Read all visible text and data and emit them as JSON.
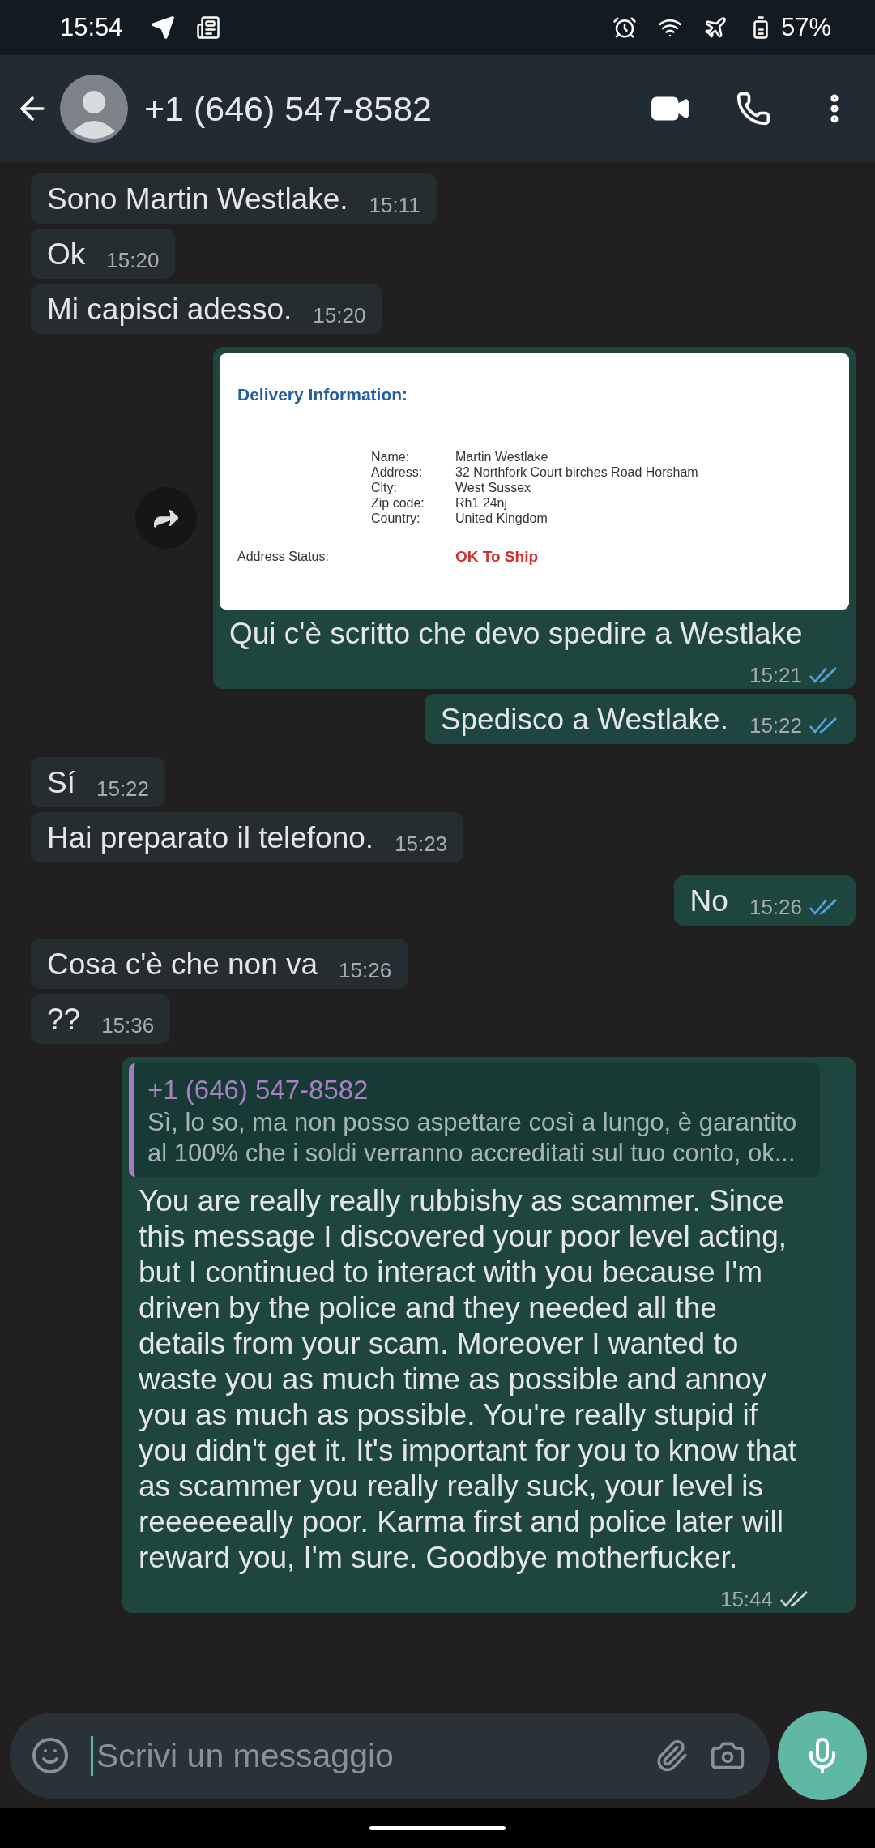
{
  "status_bar": {
    "time": "15:54",
    "battery": "57%"
  },
  "header": {
    "title": "+1 (646) 547-8582"
  },
  "messages": [
    {
      "kind": "text",
      "outgoing": false,
      "text": "Sono Martin Westlake.",
      "time": "15:11"
    },
    {
      "kind": "text",
      "outgoing": false,
      "text": "Ok",
      "time": "15:20"
    },
    {
      "kind": "text",
      "outgoing": false,
      "text": "Mi capisci adesso.",
      "time": "15:20"
    },
    {
      "kind": "image",
      "outgoing": true,
      "read": true,
      "document": {
        "title": "Delivery Information:",
        "rows": [
          {
            "label": "Name:",
            "value": "Martin Westlake"
          },
          {
            "label": "Address:",
            "value": "32 Northfork Court birches Road Horsham"
          },
          {
            "label": "City:",
            "value": "West Sussex"
          },
          {
            "label": "Zip code:",
            "value": "Rh1 24nj"
          },
          {
            "label": "Country:",
            "value": "United Kingdom"
          }
        ],
        "status_label": "Address Status:",
        "status_value": "OK To Ship"
      },
      "text": "Qui c'è scritto che devo spedire a Westlake",
      "time": "15:21"
    },
    {
      "kind": "text",
      "outgoing": true,
      "read": true,
      "text": "Spedisco a Westlake.",
      "time": "15:22"
    },
    {
      "kind": "text",
      "outgoing": false,
      "text": "Sí",
      "time": "15:22"
    },
    {
      "kind": "text",
      "outgoing": false,
      "text": "Hai preparato il telefono.",
      "time": "15:23"
    },
    {
      "kind": "text",
      "outgoing": true,
      "read": true,
      "text": "No",
      "time": "15:26"
    },
    {
      "kind": "text",
      "outgoing": false,
      "text": "Cosa c'è che non va",
      "time": "15:26"
    },
    {
      "kind": "text",
      "outgoing": false,
      "text": "??",
      "time": "15:36"
    },
    {
      "kind": "reply",
      "outgoing": true,
      "read": false,
      "quote": {
        "author": "+1 (646) 547-8582",
        "text": "Sì, lo so, ma non posso aspettare così a lungo, è garantito al 100% che i soldi verranno accreditati sul tuo conto, ok..."
      },
      "text": "You are really really rubbishy as scammer. Since this message I discovered your poor level acting, but I continued to interact with you because I'm driven by the police and they needed all the details from your scam. Moreover I wanted to waste you as much time as possible and annoy you as much as possible. You're really stupid if you didn't get it. It's important for you to know that as scammer you really really suck, your level is reeeeeeally poor. Karma first and police later will reward you, I'm sure. Goodbye motherfucker.",
      "time": "15:44"
    }
  ],
  "composer": {
    "placeholder": "Scrivi un messaggio"
  }
}
